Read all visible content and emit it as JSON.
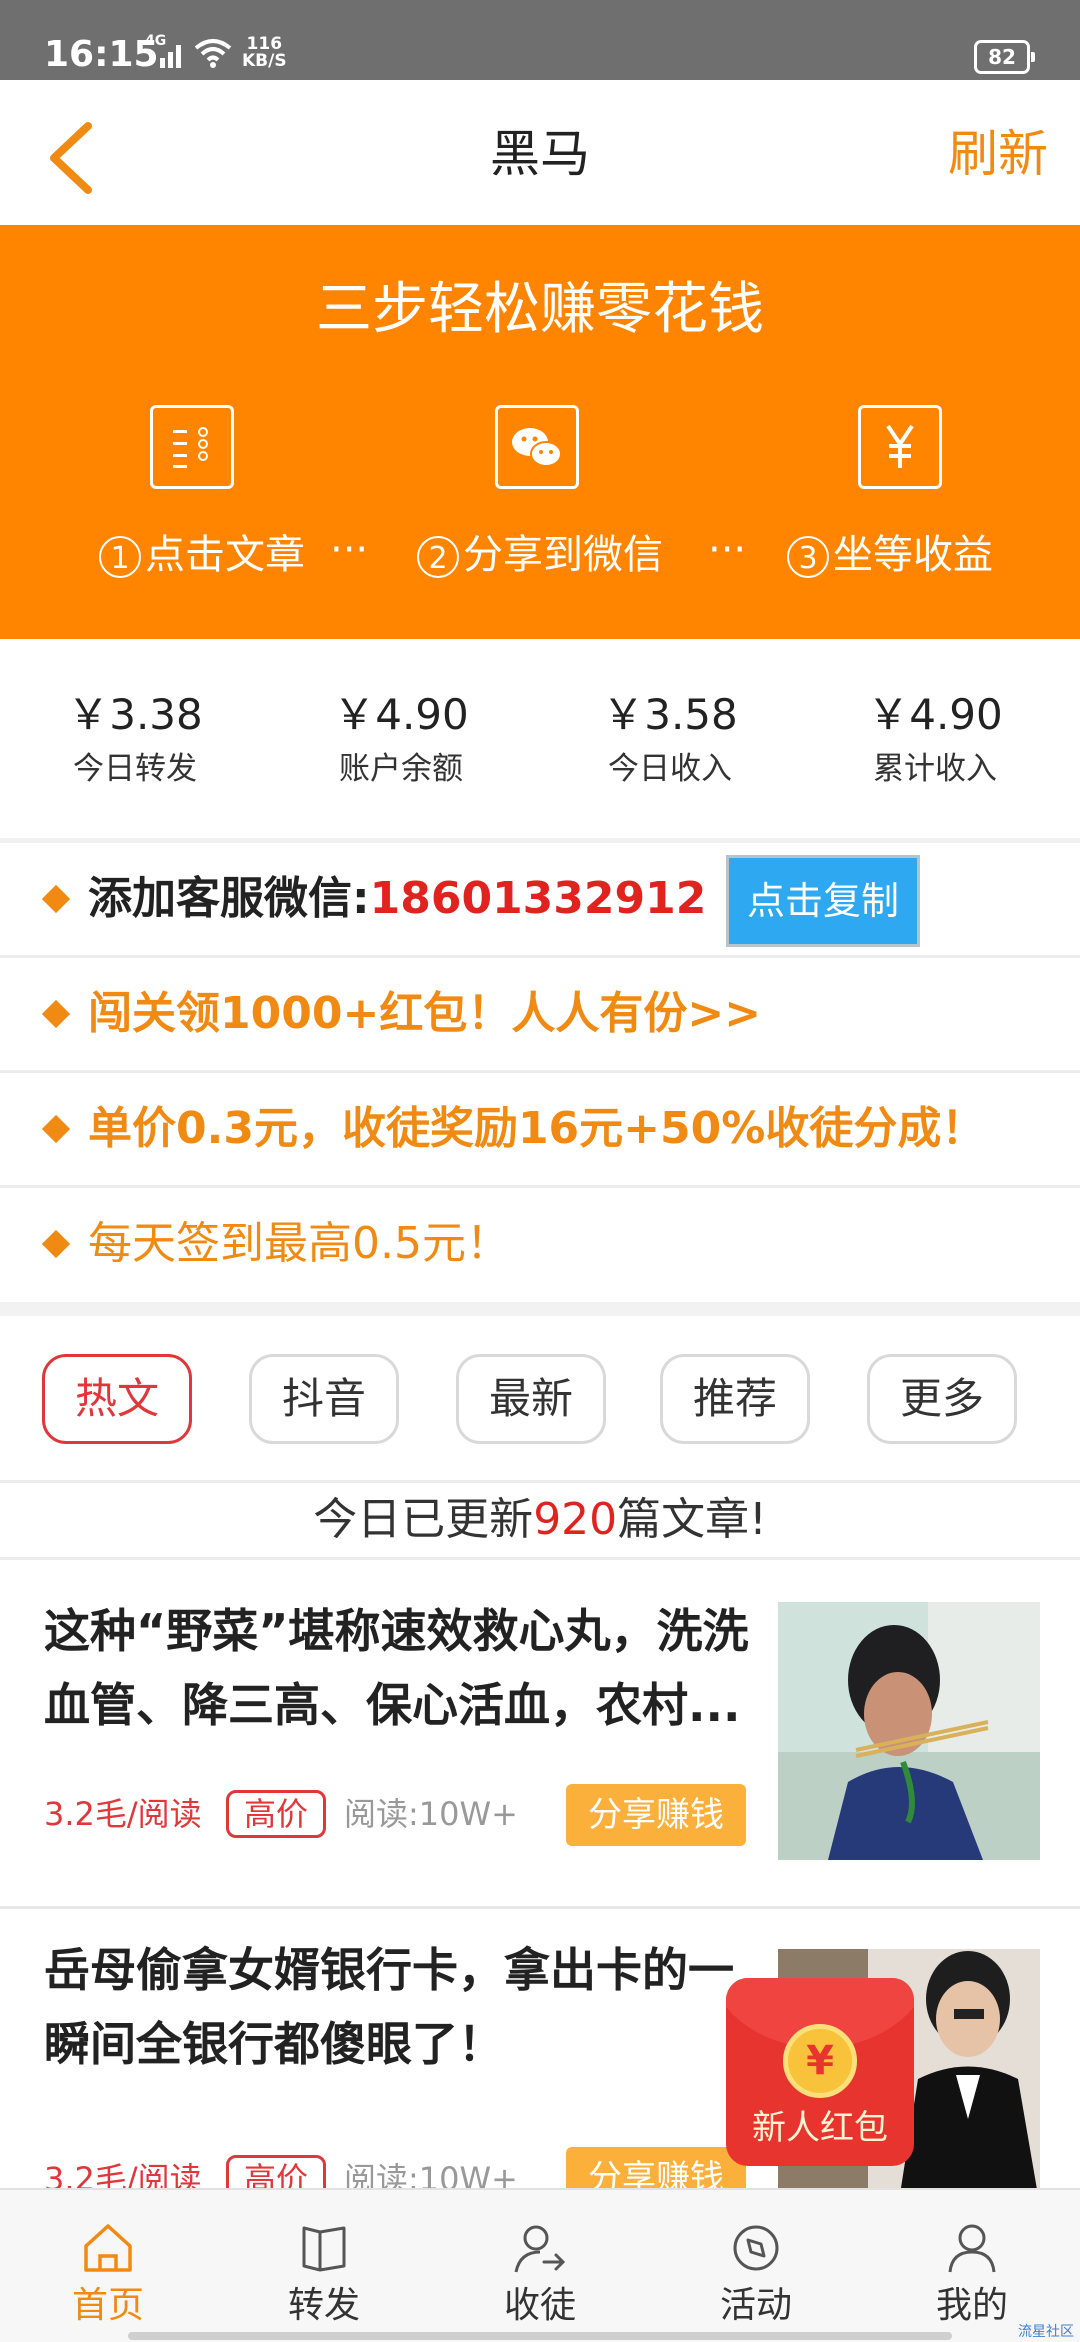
{
  "status_bar": {
    "time": "16:15",
    "network": "4G",
    "speed_value": "116",
    "speed_unit": "KB/S",
    "battery": "82"
  },
  "header": {
    "title": "黑马",
    "refresh_label": "刷新",
    "back_icon": "chevron-left-icon"
  },
  "banner": {
    "title": "三步轻松赚零花钱",
    "steps": [
      {
        "num": "1",
        "label": "点击文章",
        "icon": "article-list-icon"
      },
      {
        "num": "2",
        "label": "分享到微信",
        "icon": "wechat-icon"
      },
      {
        "num": "3",
        "label": "坐等收益",
        "icon": "yuan-icon"
      }
    ],
    "separator": "···",
    "accent_color": "#ff8400"
  },
  "stats": [
    {
      "value": "￥3.38",
      "label": "今日转发"
    },
    {
      "value": "￥4.90",
      "label": "账户余额"
    },
    {
      "value": "￥3.58",
      "label": "今日收入"
    },
    {
      "value": "￥4.90",
      "label": "累计收入"
    }
  ],
  "notices": {
    "contact_label": "添加客服微信:",
    "contact_number": "18601332912",
    "copy_button": "点击复制",
    "challenge": "闯关领1000+红包！人人有份>>",
    "reward": "单价0.3元，收徒奖励16元+50%收徒分成！",
    "checkin": "每天签到最高0.5元！"
  },
  "tabs": [
    {
      "label": "热文",
      "active": true
    },
    {
      "label": "抖音",
      "active": false
    },
    {
      "label": "最新",
      "active": false
    },
    {
      "label": "推荐",
      "active": false
    },
    {
      "label": "更多",
      "active": false
    }
  ],
  "update_notice": {
    "prefix": "今日已更新",
    "count": "920",
    "suffix": "篇文章!"
  },
  "articles": [
    {
      "title": "这种“野菜”堪称速效救心丸，洗洗血管、降三高、保心活血，农村...",
      "price": "3.2毛/阅读",
      "tag": "高价",
      "reads": "阅读:10W+",
      "share": "分享赚钱"
    },
    {
      "title": "岳母偷拿女婿银行卡，拿出卡的一瞬间全银行都傻眼了！",
      "price": "3.2毛/阅读",
      "tag": "高价",
      "reads": "阅读:10W+",
      "share": "分享赚钱"
    }
  ],
  "red_packet": {
    "symbol": "¥",
    "label": "新人红包"
  },
  "bottom_nav": [
    {
      "label": "首页",
      "icon": "home-icon",
      "active": true
    },
    {
      "label": "转发",
      "icon": "book-icon",
      "active": false
    },
    {
      "label": "收徒",
      "icon": "add-user-icon",
      "active": false
    },
    {
      "label": "活动",
      "icon": "compass-icon",
      "active": false
    },
    {
      "label": "我的",
      "icon": "profile-icon",
      "active": false
    }
  ],
  "watermark": "流星社区"
}
